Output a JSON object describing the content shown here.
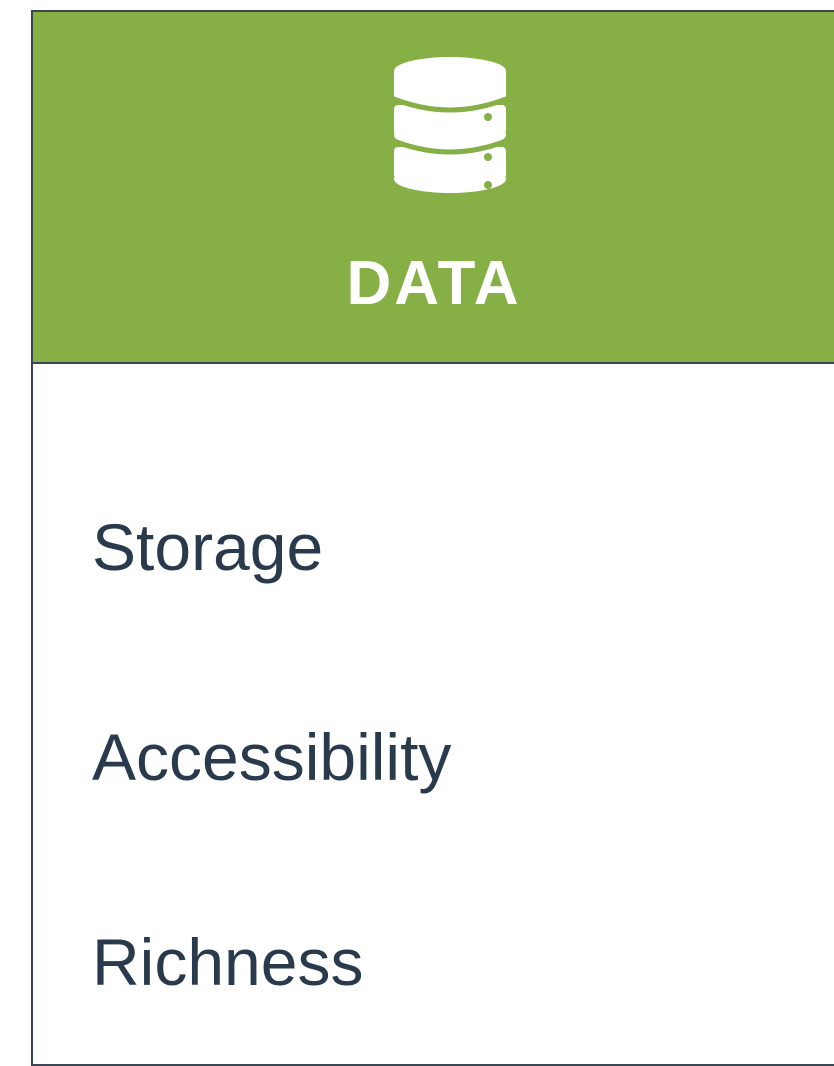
{
  "card": {
    "header": {
      "title": "DATA",
      "icon": "database-icon",
      "background_color": "#86b045",
      "text_color": "#ffffff"
    },
    "items": [
      {
        "label": "Storage"
      },
      {
        "label": "Accessibility"
      },
      {
        "label": "Richness"
      }
    ],
    "border_color": "#3a4652",
    "item_text_color": "#2a3a4d"
  }
}
